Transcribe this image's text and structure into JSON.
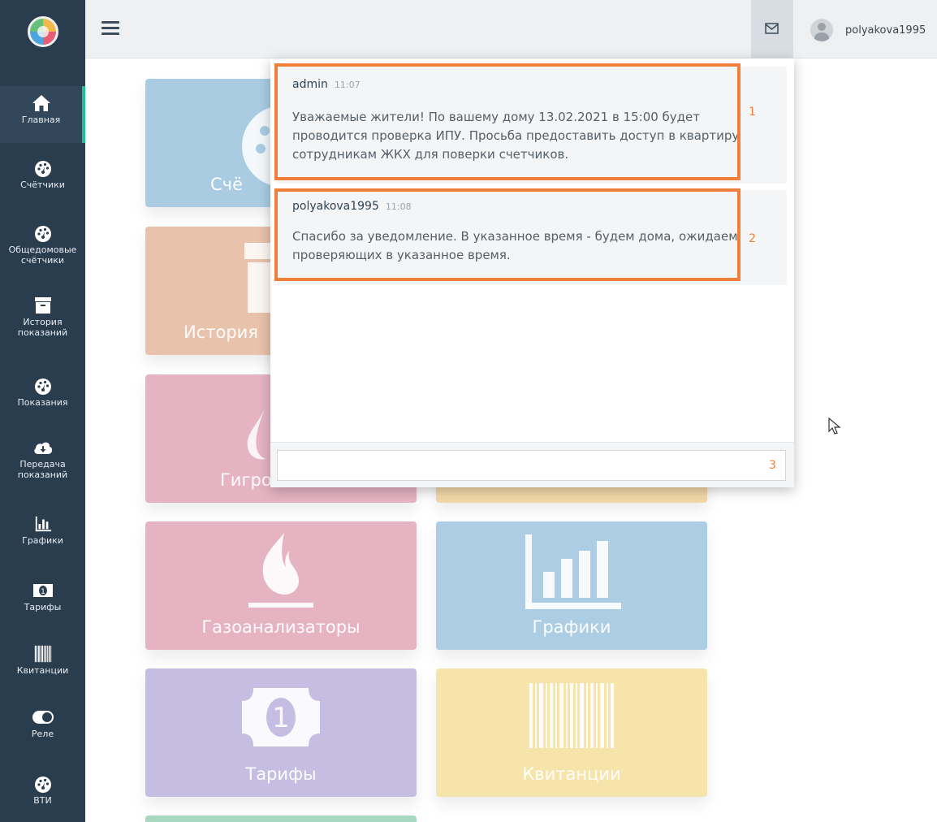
{
  "header": {
    "username": "polyakova1995"
  },
  "sidebar": {
    "items": [
      {
        "label": "Главная",
        "icon": "home-icon"
      },
      {
        "label": "Счётчики",
        "icon": "dashboard-gauge-icon"
      },
      {
        "label": "Общедомовые счётчики",
        "icon": "dashboard-gauge-icon"
      },
      {
        "label": "История показаний",
        "icon": "archive-box-icon"
      },
      {
        "label": "Показания",
        "icon": "dashboard-gauge-icon"
      },
      {
        "label": "Передача показаний",
        "icon": "cloud-download-icon"
      },
      {
        "label": "Графики",
        "icon": "bar-chart-icon"
      },
      {
        "label": "Тарифы",
        "icon": "money-bill-icon"
      },
      {
        "label": "Квитанции",
        "icon": "barcode-icon"
      },
      {
        "label": "Реле",
        "icon": "toggle-icon"
      },
      {
        "label": "ВТИ",
        "icon": "dashboard-gauge-icon"
      }
    ]
  },
  "tiles": [
    {
      "label": "Счё",
      "color": "#aacce3",
      "icon": "dashboard-gauge-icon"
    },
    {
      "label": "История",
      "color": "#e8c2aa",
      "icon": "archive-box-icon"
    },
    {
      "label": "Гигро",
      "color": "#e5b4c3",
      "icon": "water-drop-icon"
    },
    {
      "label": "Газоанализаторы",
      "color": "#e5b3c2",
      "icon": "fire-icon"
    },
    {
      "label": "Графики",
      "color": "#accde3",
      "icon": "bar-chart-icon"
    },
    {
      "label": "Тарифы",
      "color": "#c6bde3",
      "icon": "money-bill-icon"
    },
    {
      "label": "Квитанции",
      "color": "#f6e4ab",
      "icon": "barcode-icon"
    }
  ],
  "chat": {
    "messages": [
      {
        "author": "admin",
        "time": "11:07",
        "text": "Уважаемые жители! По вашему дому 13.02.2021 в 15:00 будет проводится проверка ИПУ. Просьба предоставить доступ в квартиру сотрудникам ЖКХ для поверки счетчиков.",
        "marker": "1"
      },
      {
        "author": "polyakova1995",
        "time": "11:08",
        "text": "Спасибо за уведомление. В указанное время - будем дома, ожидаем проверяющих в указанное время.",
        "marker": "2"
      }
    ],
    "input_value": "",
    "input_marker": "3"
  },
  "colors": {
    "sidebar_bg": "#2a3d4f",
    "active_accent": "#1ebf9a",
    "highlight_border": "#ef7f3a"
  }
}
